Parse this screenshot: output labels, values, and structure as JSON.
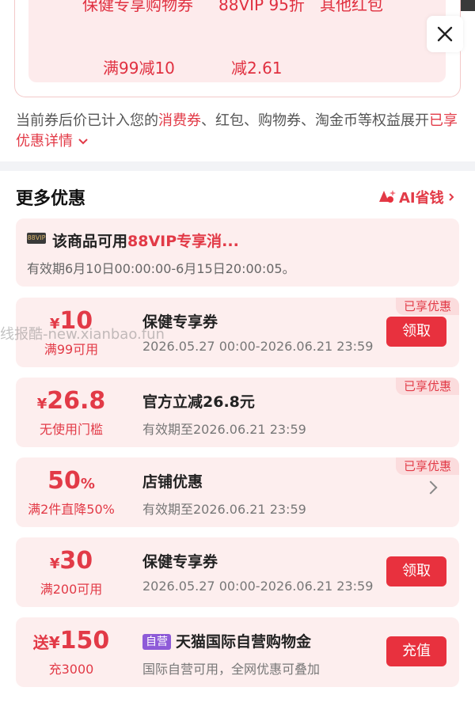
{
  "top": {
    "cut_labels": [
      "保健专享购物券",
      "88VIP 95折",
      "其他红包"
    ],
    "values": [
      "满99减10",
      "减2.61"
    ]
  },
  "info": {
    "prefix": "当前券后价已计入您的",
    "highlight": "消费券",
    "rest": "、红包、购物券、淘金币等权益展开",
    "link": "已享优惠详情"
  },
  "section": {
    "title": "更多优惠",
    "ai_label": "AI省钱"
  },
  "vip": {
    "badge": "88VIP",
    "title_prefix": "该商品可用",
    "title_highlight": "88VIP专享消...",
    "validity": "有效期6月10日00:00:00-6月15日20:00:05。"
  },
  "coupons": [
    {
      "symbol": "¥",
      "value": "10",
      "suffix": "",
      "cond": "满99可用",
      "name": "保健专享券",
      "date": "2026.05.27 00:00-2026.06.21 23:59",
      "tag": "已享优惠",
      "button": "领取"
    },
    {
      "symbol": "¥",
      "value": "26.8",
      "suffix": "",
      "cond": "无使用门槛",
      "name": "官方立减26.8元",
      "date": "有效期至2026.06.21 23:59",
      "tag": "已享优惠",
      "button": ""
    },
    {
      "symbol": "",
      "value": "50",
      "suffix": "%",
      "cond": "满2件直降50%",
      "name": "店铺优惠",
      "date": "有效期至2026.06.21 23:59",
      "tag": "已享优惠",
      "button": ""
    },
    {
      "symbol": "¥",
      "value": "30",
      "suffix": "",
      "cond": "满200可用",
      "name": "保健专享券",
      "date": "2026.05.27 00:00-2026.06.21 23:59",
      "tag": "",
      "button": "领取"
    },
    {
      "symbol": "送¥",
      "value": "150",
      "suffix": "",
      "cond": "充3000",
      "badge": "自营",
      "name": "天猫国际自营购物金",
      "date": "国际自营可用，全网优惠可叠加",
      "tag": "",
      "button": "充值"
    }
  ],
  "watermark": "线报酷-new.xianbao.fun",
  "colors": {
    "accent": "#e23a47",
    "button": "#e8313e",
    "card_bg": "#fdeeee"
  }
}
